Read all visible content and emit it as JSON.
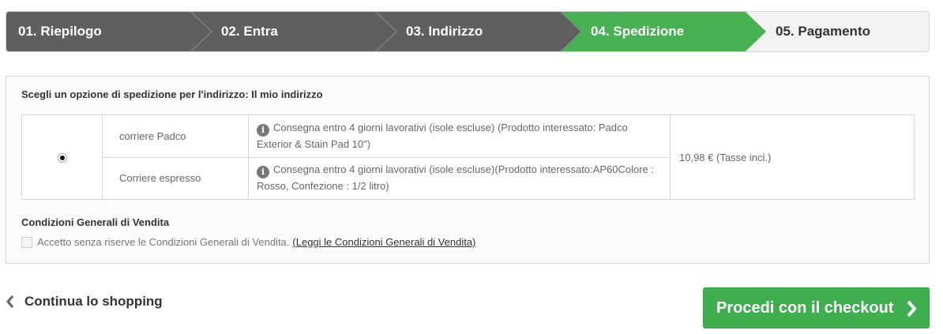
{
  "steps": [
    {
      "label": "01. Riepilogo",
      "state": "done"
    },
    {
      "label": "02. Entra",
      "state": "done"
    },
    {
      "label": "03. Indirizzo",
      "state": "done"
    },
    {
      "label": "04. Spedizione",
      "state": "active"
    },
    {
      "label": "05. Pagamento",
      "state": "todo"
    }
  ],
  "colors": {
    "done": "#5f5f5f",
    "active": "#46b052",
    "todo": "#f2f2f2",
    "button": "#3fae4f"
  },
  "shipping": {
    "title": "Scegli un opzione di spedizione per l'indirizzo: Il mio indirizzo",
    "options": [
      {
        "carrier": "corriere Padco",
        "description": "Consegna entro 4 giorni lavorativi (isole escluse) (Prodotto interessato: Padco Exterior & Stain Pad 10\")"
      },
      {
        "carrier": "Corriere espresso",
        "description": "Consegna entro 4 giorni lavorativi (isole escluse)(Prodotto interessato:AP60Colore : Rosso, Confezione : 1/2 litro)"
      }
    ],
    "price": "10,98 € (Tasse incl.)",
    "info_icon": "info-icon"
  },
  "terms": {
    "title": "Condizioni Generali di Vendita",
    "accept_label": "Accetto senza riserve le Condizioni Generali di Vendita.",
    "link_label": "(Leggi le Condizioni Generali di Vendita)"
  },
  "footer": {
    "continue_label": "Continua lo shopping",
    "checkout_label": "Procedi con il checkout"
  }
}
